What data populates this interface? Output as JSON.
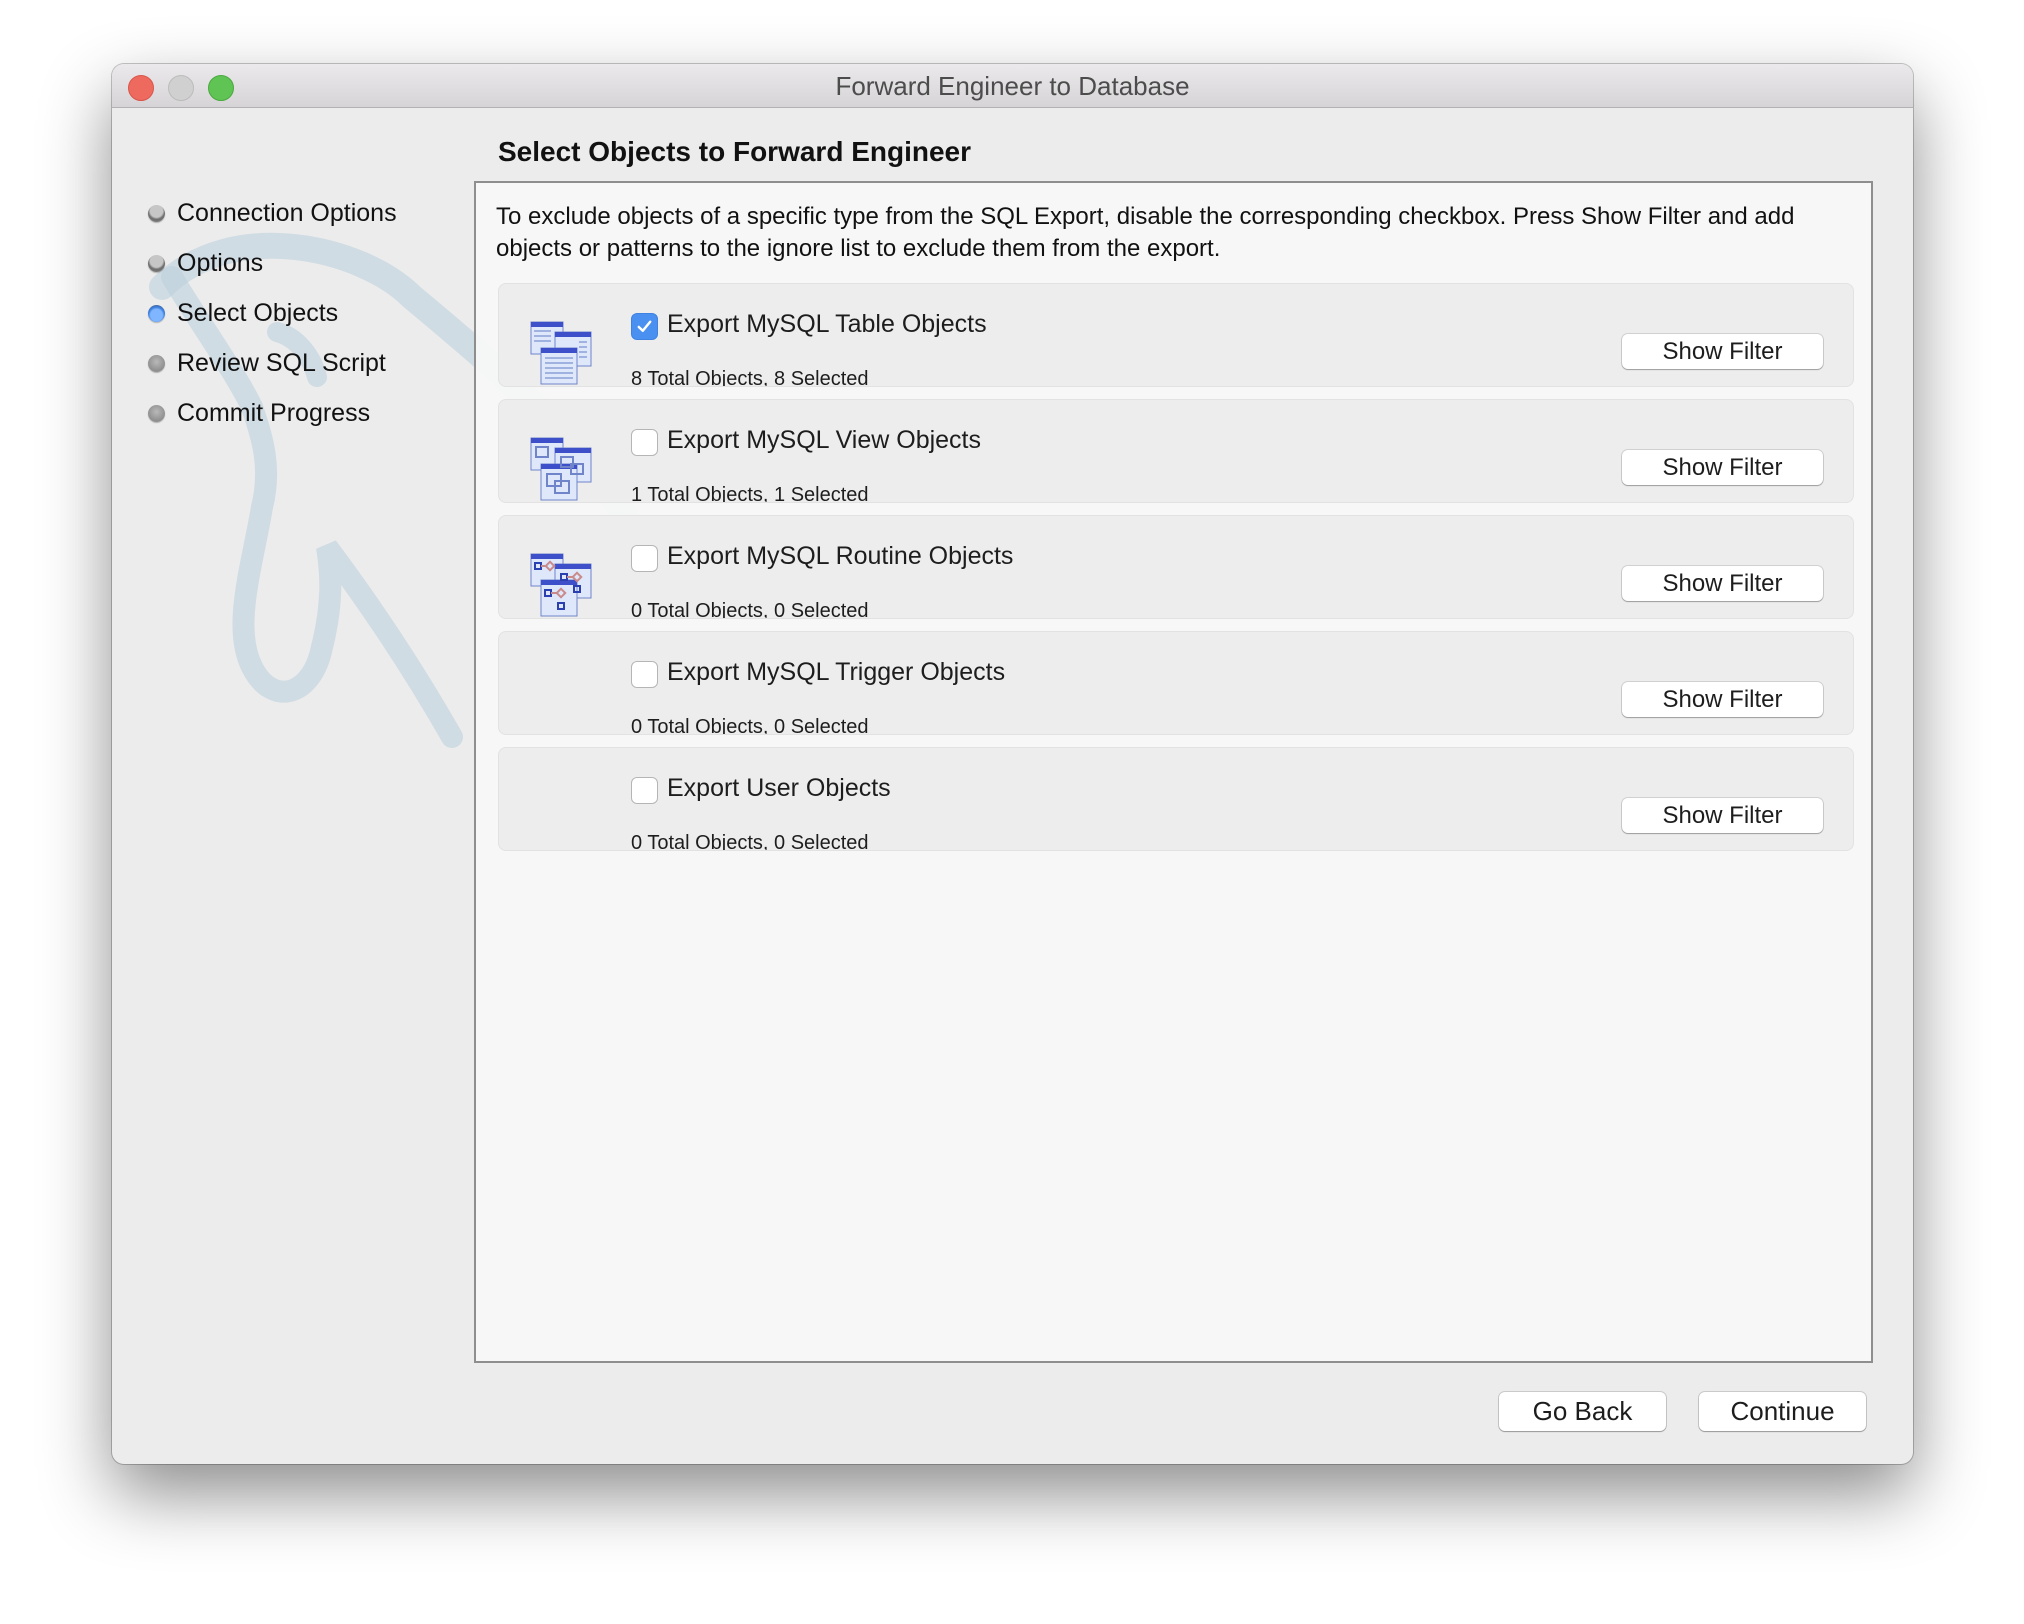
{
  "window": {
    "title": "Forward Engineer to Database",
    "controls": [
      "close",
      "minimize",
      "zoom"
    ]
  },
  "sidebar": {
    "steps": [
      {
        "label": "Connection Options",
        "state": "done"
      },
      {
        "label": "Options",
        "state": "done"
      },
      {
        "label": "Select Objects",
        "state": "active"
      },
      {
        "label": "Review SQL Script",
        "state": "pending"
      },
      {
        "label": "Commit Progress",
        "state": "pending"
      }
    ]
  },
  "main": {
    "heading": "Select Objects to Forward Engineer",
    "description": "To exclude objects of a specific type from the SQL Export, disable the corresponding checkbox. Press Show Filter and add objects or patterns to the ignore list to exclude them from the export.",
    "groups": [
      {
        "label": "Export MySQL Table Objects",
        "checked": true,
        "count": "8 Total Objects, 8 Selected",
        "icon": "table-objects-icon",
        "filter_label": "Show Filter"
      },
      {
        "label": "Export MySQL View Objects",
        "checked": false,
        "count": "1 Total Objects, 1 Selected",
        "icon": "view-objects-icon",
        "filter_label": "Show Filter"
      },
      {
        "label": "Export MySQL Routine Objects",
        "checked": false,
        "count": "0 Total Objects, 0 Selected",
        "icon": "routine-objects-icon",
        "filter_label": "Show Filter"
      },
      {
        "label": "Export MySQL Trigger Objects",
        "checked": false,
        "count": "0 Total Objects, 0 Selected",
        "icon": null,
        "filter_label": "Show Filter"
      },
      {
        "label": "Export User Objects",
        "checked": false,
        "count": "0 Total Objects, 0 Selected",
        "icon": null,
        "filter_label": "Show Filter"
      }
    ]
  },
  "footer": {
    "go_back_label": "Go Back",
    "continue_label": "Continue"
  },
  "colors": {
    "accent": "#4a90f0",
    "close": "#ee6a5f",
    "zoom": "#5fc454"
  }
}
